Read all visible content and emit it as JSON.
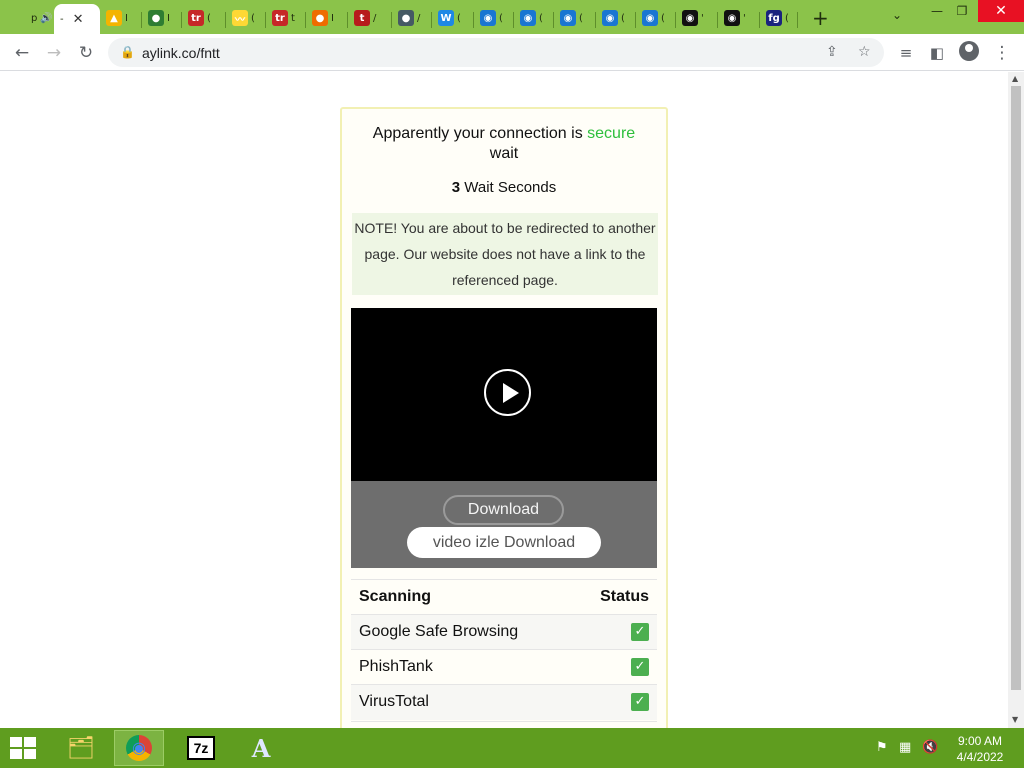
{
  "browser": {
    "tabs": [
      {
        "name": "tab-1",
        "fav_color": "#8bc34a",
        "fav_glyph": "",
        "title": "p",
        "extra": "🔊"
      },
      {
        "name": "tab-2-active",
        "fav_color": "#ffffff",
        "fav_glyph": "",
        "title": "-",
        "extra": "✕"
      },
      {
        "name": "tab-3",
        "fav_color": "#f4b400",
        "fav_glyph": "▲",
        "title": "I",
        "extra": ""
      },
      {
        "name": "tab-4",
        "fav_color": "#2e7d32",
        "fav_glyph": "●",
        "title": "I",
        "extra": ""
      },
      {
        "name": "tab-5",
        "fav_color": "#c62828",
        "fav_glyph": "tr",
        "title": "(",
        "extra": ""
      },
      {
        "name": "tab-6",
        "fav_color": "#fdd835",
        "fav_glyph": "〰",
        "title": "(",
        "extra": ""
      },
      {
        "name": "tab-7",
        "fav_color": "#c62828",
        "fav_glyph": "tr",
        "title": "t",
        "extra": ""
      },
      {
        "name": "tab-8",
        "fav_color": "#ef6c00",
        "fav_glyph": "●",
        "title": "I",
        "extra": ""
      },
      {
        "name": "tab-9",
        "fav_color": "#b71c1c",
        "fav_glyph": "t",
        "title": "/",
        "extra": ""
      },
      {
        "name": "tab-10",
        "fav_color": "#455a64",
        "fav_glyph": "●",
        "title": "/",
        "extra": ""
      },
      {
        "name": "tab-11",
        "fav_color": "#1e88e5",
        "fav_glyph": "W",
        "title": "(",
        "extra": ""
      },
      {
        "name": "tab-12",
        "fav_color": "#1976d2",
        "fav_glyph": "◉",
        "title": "(",
        "extra": ""
      },
      {
        "name": "tab-13",
        "fav_color": "#1976d2",
        "fav_glyph": "◉",
        "title": "(",
        "extra": ""
      },
      {
        "name": "tab-14",
        "fav_color": "#1976d2",
        "fav_glyph": "◉",
        "title": "(",
        "extra": ""
      },
      {
        "name": "tab-15",
        "fav_color": "#1976d2",
        "fav_glyph": "◉",
        "title": "(",
        "extra": ""
      },
      {
        "name": "tab-16",
        "fav_color": "#1976d2",
        "fav_glyph": "◉",
        "title": "(",
        "extra": ""
      },
      {
        "name": "tab-17",
        "fav_color": "#111111",
        "fav_glyph": "◉",
        "title": "'",
        "extra": ""
      },
      {
        "name": "tab-18",
        "fav_color": "#111111",
        "fav_glyph": "◉",
        "title": "'",
        "extra": ""
      },
      {
        "name": "tab-19",
        "fav_color": "#1a237e",
        "fav_glyph": "fg",
        "title": "(",
        "extra": ""
      }
    ],
    "new_tab": "+",
    "tab_search": "⌄",
    "window_buttons": {
      "minimize": "—",
      "restore": "❐",
      "close": "✕"
    },
    "toolbar": {
      "back": "←",
      "forward": "→",
      "reload": "↻",
      "lock": "🔒",
      "url": "aylink.co/fntt",
      "share": "⇪",
      "star": "☆",
      "media": "≡",
      "sidepanel": "◧",
      "menu": "⋮"
    },
    "colors": {
      "tabstrip": "#8bc34a",
      "taskbar": "#5f9d1f"
    }
  },
  "page": {
    "headline_prefix": "Apparently your connection is",
    "headline_secure": "secure",
    "headline_wait": "wait",
    "timer_count": "3",
    "timer_label": "Wait Seconds",
    "note": "NOTE! You are about to be redirected to another page. Our website does not have a link to the referenced page.",
    "video": {
      "play_icon": "play-icon"
    },
    "download_label": "Download",
    "izle_label": "video izle Download",
    "scan_table": {
      "headers": [
        "Scanning",
        "Status"
      ],
      "rows": [
        {
          "name": "Google Safe Browsing",
          "status": "✓"
        },
        {
          "name": "PhishTank",
          "status": "✓"
        },
        {
          "name": "VirusTotal",
          "status": "✓"
        }
      ]
    },
    "colors": {
      "secure": "#2ebf3c",
      "check": "#4caf50",
      "card_border": "#f2f0b3"
    }
  },
  "taskbar": {
    "apps": [
      {
        "name": "file-explorer",
        "glyph": "🗂",
        "active": false
      },
      {
        "name": "chrome",
        "glyph": "◉",
        "active": true
      },
      {
        "name": "7zip",
        "glyph": "7z",
        "active": false
      },
      {
        "name": "app-a",
        "glyph": "A",
        "active": false
      }
    ],
    "tray": {
      "flag": "⚑",
      "network": "▦",
      "volume": "🔇"
    },
    "clock_time": "9:00 AM",
    "clock_date": "4/4/2022"
  }
}
